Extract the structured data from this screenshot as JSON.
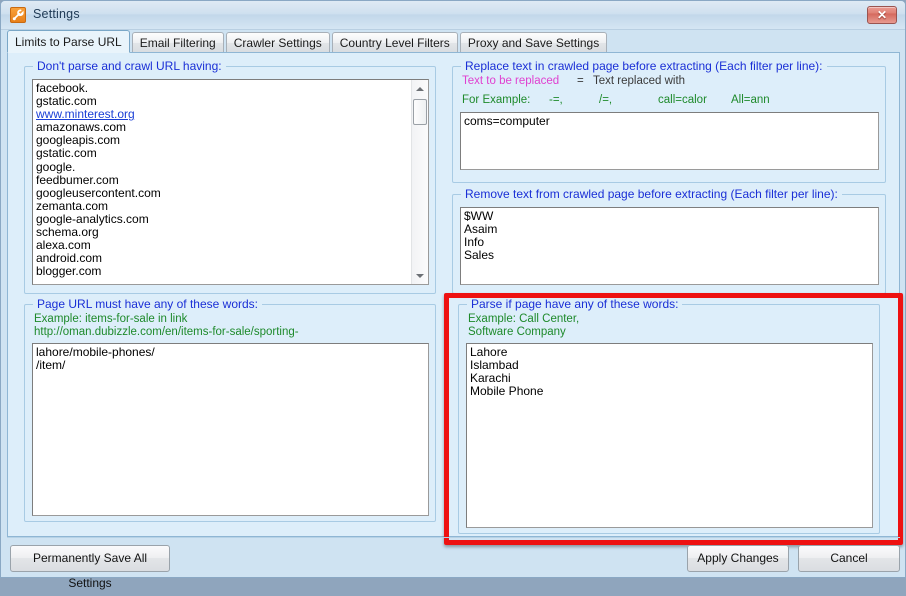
{
  "window": {
    "title": "Settings",
    "icon": "wrench-icon",
    "close_label": "✕"
  },
  "tabs": [
    {
      "label": "Limits to Parse URL",
      "active": true
    },
    {
      "label": "Email Filtering",
      "active": false
    },
    {
      "label": "Crawler Settings",
      "active": false
    },
    {
      "label": "Country Level Filters",
      "active": false
    },
    {
      "label": "Proxy and Save Settings",
      "active": false
    }
  ],
  "groups": {
    "exclude_urls": {
      "legend": "Don't parse and crawl URL having:",
      "lines": [
        {
          "text": "facebook.",
          "link": false
        },
        {
          "text": "gstatic.com",
          "link": false
        },
        {
          "text": "www.minterest.org",
          "link": true
        },
        {
          "text": "amazonaws.com",
          "link": false
        },
        {
          "text": "googleapis.com",
          "link": false
        },
        {
          "text": "gstatic.com",
          "link": false
        },
        {
          "text": "google.",
          "link": false
        },
        {
          "text": "feedbumer.com",
          "link": false
        },
        {
          "text": "googleusercontent.com",
          "link": false
        },
        {
          "text": "zemanta.com",
          "link": false
        },
        {
          "text": "google-analytics.com",
          "link": false
        },
        {
          "text": "schema.org",
          "link": false
        },
        {
          "text": "alexa.com",
          "link": false
        },
        {
          "text": "android.com",
          "link": false
        },
        {
          "text": "blogger.com",
          "link": false
        }
      ]
    },
    "replace_text": {
      "legend": "Replace text in crawled page before extracting (Each filter per line):",
      "hint_left": "Text to be replaced",
      "hint_eq": "=",
      "hint_right": "Text replaced with",
      "example_label": "For Example:",
      "example_items": [
        "-=,",
        "/=,",
        "call=calor",
        "All=ann"
      ],
      "lines": [
        "coms=computer"
      ]
    },
    "remove_text": {
      "legend": "Remove text from crawled page before extracting (Each filter per line):",
      "lines": [
        "$WW",
        "Asaim",
        "Info",
        "Sales"
      ]
    },
    "url_must_have": {
      "legend": "Page URL must have any of these words:",
      "example_line1": "Example: items-for-sale in link",
      "example_line2": "http://oman.dubizzle.com/en/items-for-sale/sporting-",
      "lines": [
        "lahore/mobile-phones/",
        "/item/"
      ]
    },
    "parse_if_words": {
      "legend": "Parse if page have any of these words:",
      "example_line1": "Example: Call Center,",
      "example_line2": "Software Company",
      "lines": [
        "Lahore",
        "Islambad",
        "Karachi",
        "Mobile Phone"
      ],
      "highlight_color": "#ee1111"
    }
  },
  "buttons": {
    "permanent_save": "Permanently Save All Settings",
    "apply": "Apply Changes",
    "cancel": "Cancel"
  }
}
